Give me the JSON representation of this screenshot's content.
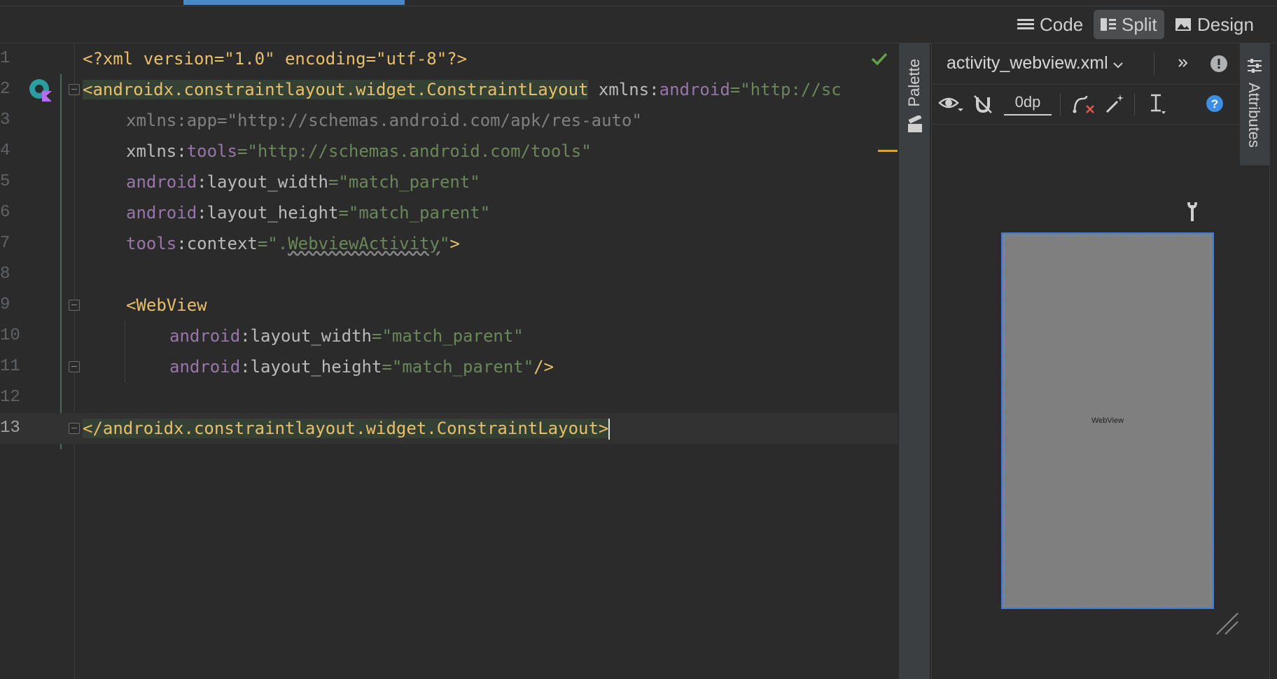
{
  "view_modes": {
    "code": "Code",
    "split": "Split",
    "design": "Design",
    "active": "Split"
  },
  "editor": {
    "lines": [
      {
        "n": "1"
      },
      {
        "n": "2"
      },
      {
        "n": "3"
      },
      {
        "n": "4"
      },
      {
        "n": "5"
      },
      {
        "n": "6"
      },
      {
        "n": "7"
      },
      {
        "n": "8"
      },
      {
        "n": "9"
      },
      {
        "n": "10"
      },
      {
        "n": "11"
      },
      {
        "n": "12"
      },
      {
        "n": "13"
      }
    ],
    "tokens": {
      "l1_decl": "<?xml version=\"1.0\" encoding=\"utf-8\"?>",
      "l2_tag": "<androidx.constraintlayout.widget.ConstraintLayout",
      "l2_attr": " xmlns:",
      "l2_ns": "android",
      "l2_str": "=\"http://sc",
      "l3_gray": "xmlns:app=\"http://schemas.android.com/apk/res-auto\"",
      "l4_attr": "xmlns:",
      "l4_ns": "tools",
      "l4_str": "=\"http://schemas.android.com/tools\"",
      "l5_ns": "android",
      "l5_attr": ":layout_width",
      "l5_str": "=\"match_parent\"",
      "l6_ns": "android",
      "l6_attr": ":layout_height",
      "l6_str": "=\"match_parent\"",
      "l7_ns": "tools",
      "l7_attr": ":context",
      "l7_str_a": "=\".",
      "l7_str_b": "WebviewActivity",
      "l7_str_c": "\"",
      "l7_tag": ">",
      "l9_tag": "<WebView",
      "l10_ns": "android",
      "l10_attr": ":layout_width",
      "l10_str": "=\"match_parent\"",
      "l11_ns": "android",
      "l11_attr": ":layout_height",
      "l11_str": "=\"match_parent\"",
      "l11_tag": "/>",
      "l13_tag": "</androidx.constraintlayout.widget.ConstraintLayout>"
    }
  },
  "palette": {
    "label": "Palette"
  },
  "design": {
    "filename": "activity_webview.xml",
    "margin_value": "0dp",
    "preview_label": "WebView"
  },
  "attributes": {
    "label": "Attributes"
  },
  "colors": {
    "accent": "#4a88c7",
    "check": "#5fa048",
    "selection_border": "#3d7fd8"
  }
}
